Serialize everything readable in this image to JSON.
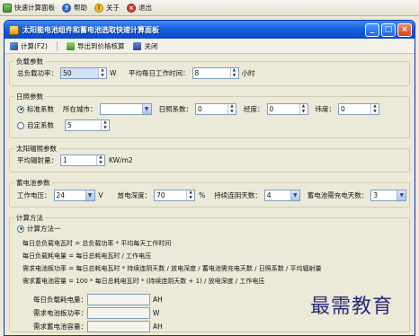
{
  "menubar": {
    "items": [
      {
        "label": "快速计算面板",
        "icon": "panel-icon"
      },
      {
        "label": "帮助",
        "icon": "help-icon"
      },
      {
        "label": "关于",
        "icon": "about-icon"
      },
      {
        "label": "退出",
        "icon": "exit-icon"
      }
    ]
  },
  "window": {
    "title": "太阳能电池组件和蓄电池选取快速计算面板",
    "controls": [
      "_",
      "□",
      "×"
    ]
  },
  "toolbar": {
    "calc_label": "计算(F2)",
    "export_label": "导出到价格核算",
    "close_label": "关闭"
  },
  "load": {
    "title": "负载参数",
    "total_power_label": "总负载功率：",
    "total_power_value": "50",
    "total_power_unit": "W",
    "daily_hours_label": "平均每日工作时间：",
    "daily_hours_value": "8",
    "daily_hours_unit": "小时"
  },
  "sunshine": {
    "title": "日照参数",
    "standard_label": "标准系数",
    "city_label": "所在城市：",
    "city_value": "",
    "coef_label": "日照系数：",
    "coef_value": "0",
    "lon_label": "经度：",
    "lon_value": "0",
    "lat_label": "纬度：",
    "lat_value": "0",
    "custom_label": "自定系数",
    "custom_value": "5"
  },
  "radiation": {
    "title": "太阳辐照参数",
    "avg_label": "平均辐射量：",
    "avg_value": "1",
    "avg_unit": "KW/m2"
  },
  "battery": {
    "title": "蓄电池参数",
    "voltage_label": "工作电压：",
    "voltage_value": "24",
    "voltage_unit": "V",
    "depth_label": "放电深度：",
    "depth_value": "70",
    "depth_unit": "%",
    "cloudy_label": "持续连阴天数：",
    "cloudy_value": "4",
    "recharge_label": "蓄电池需充电天数：",
    "recharge_value": "3"
  },
  "method": {
    "title": "计算方法",
    "method1_label": "计算方法一",
    "formulas": [
      "每日总负载电瓦时 = 总负载功率 * 平均每天工作时间",
      "每日负载耗电量 = 每日总耗电瓦时 / 工作电压",
      "需求电池板功率 = 每日总耗电瓦时 * 持续连阴天数 / 放电深度 / 蓄电池需充电天数 / 日照系数 / 平均辐射量",
      "需求蓄电池容量 = 100 * 每日总耗电瓦时 * (持续连阴天数 + 1) / 放电深度 / 工作电压"
    ]
  },
  "results": {
    "daily_consumption_label": "每日负载耗电量：",
    "daily_consumption_value": "",
    "daily_consumption_unit": "AH",
    "panel_power_label": "需求电池板功率：",
    "panel_power_value": "",
    "panel_power_unit": "W",
    "battery_capacity_label": "需求蓄电池容量：",
    "battery_capacity_value": "",
    "battery_capacity_unit": "AH"
  },
  "watermark": "最需教育"
}
